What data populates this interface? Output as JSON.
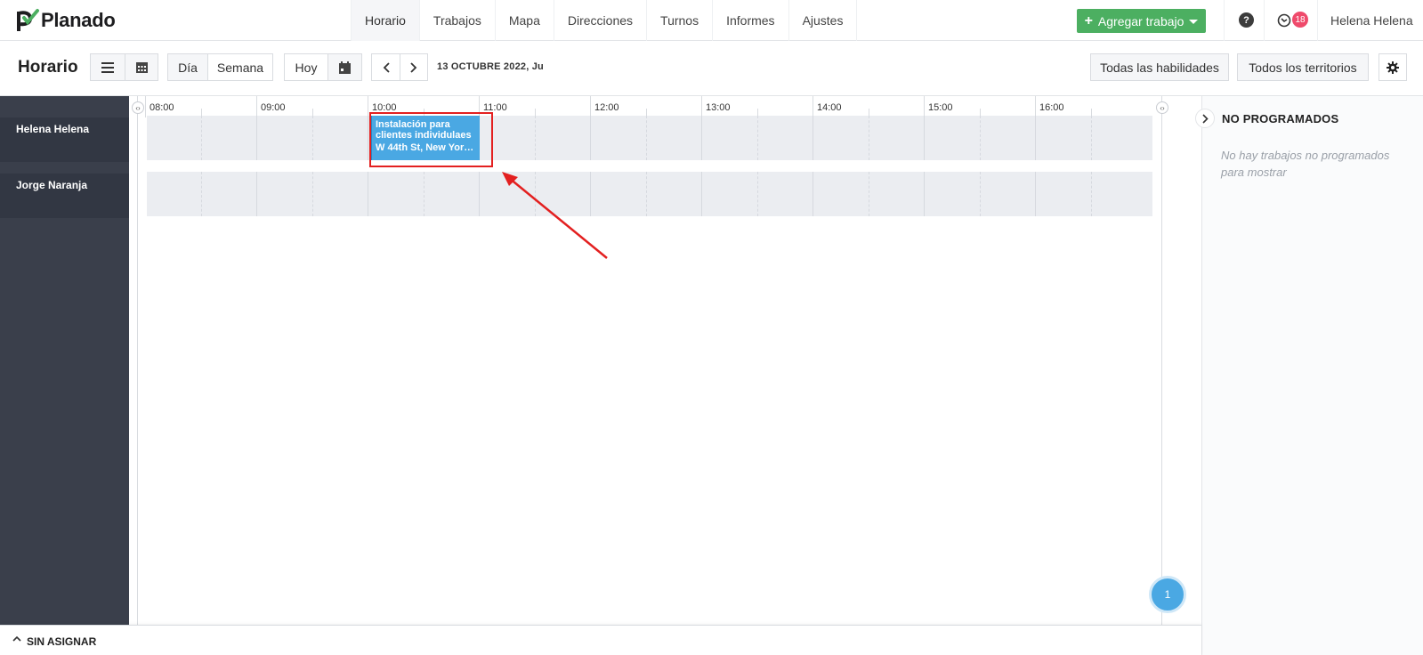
{
  "app": {
    "logo_text": "Planado",
    "brand_color": "#4caf61",
    "nav_tabs": [
      "Horario",
      "Trabajos",
      "Mapa",
      "Direcciones",
      "Turnos",
      "Informes",
      "Ajustes"
    ],
    "active_tab": "Horario",
    "add_job_label": "Agregar trabajo",
    "help_symbol": "?",
    "notification_count": "18",
    "user_name": "Helena Helena"
  },
  "toolbar": {
    "title": "Horario",
    "view_day": "Día",
    "view_week": "Semana",
    "today": "Hoy",
    "date": "13 OCTUBRE 2022, Ju",
    "skills_filter": "Todas las habilidades",
    "territories_filter": "Todos los territorios"
  },
  "schedule": {
    "hours": [
      "08:00",
      "09:00",
      "10:00",
      "11:00",
      "12:00",
      "13:00",
      "14:00",
      "15:00",
      "16:00"
    ],
    "technicians": [
      "Helena Helena",
      "Jorge Naranja"
    ],
    "job": {
      "title": "Instalación para clientes individulaes",
      "address": "W 44th St, New York,...",
      "technician": "Helena Helena",
      "start": "10:00",
      "end": "11:00",
      "color": "#4aa8e3"
    },
    "floating_count": "1"
  },
  "unscheduled": {
    "title": "NO PROGRAMADOS",
    "empty_message": "No hay trabajos no programados para mostrar"
  },
  "bottom": {
    "label": "SIN ASIGNAR"
  }
}
